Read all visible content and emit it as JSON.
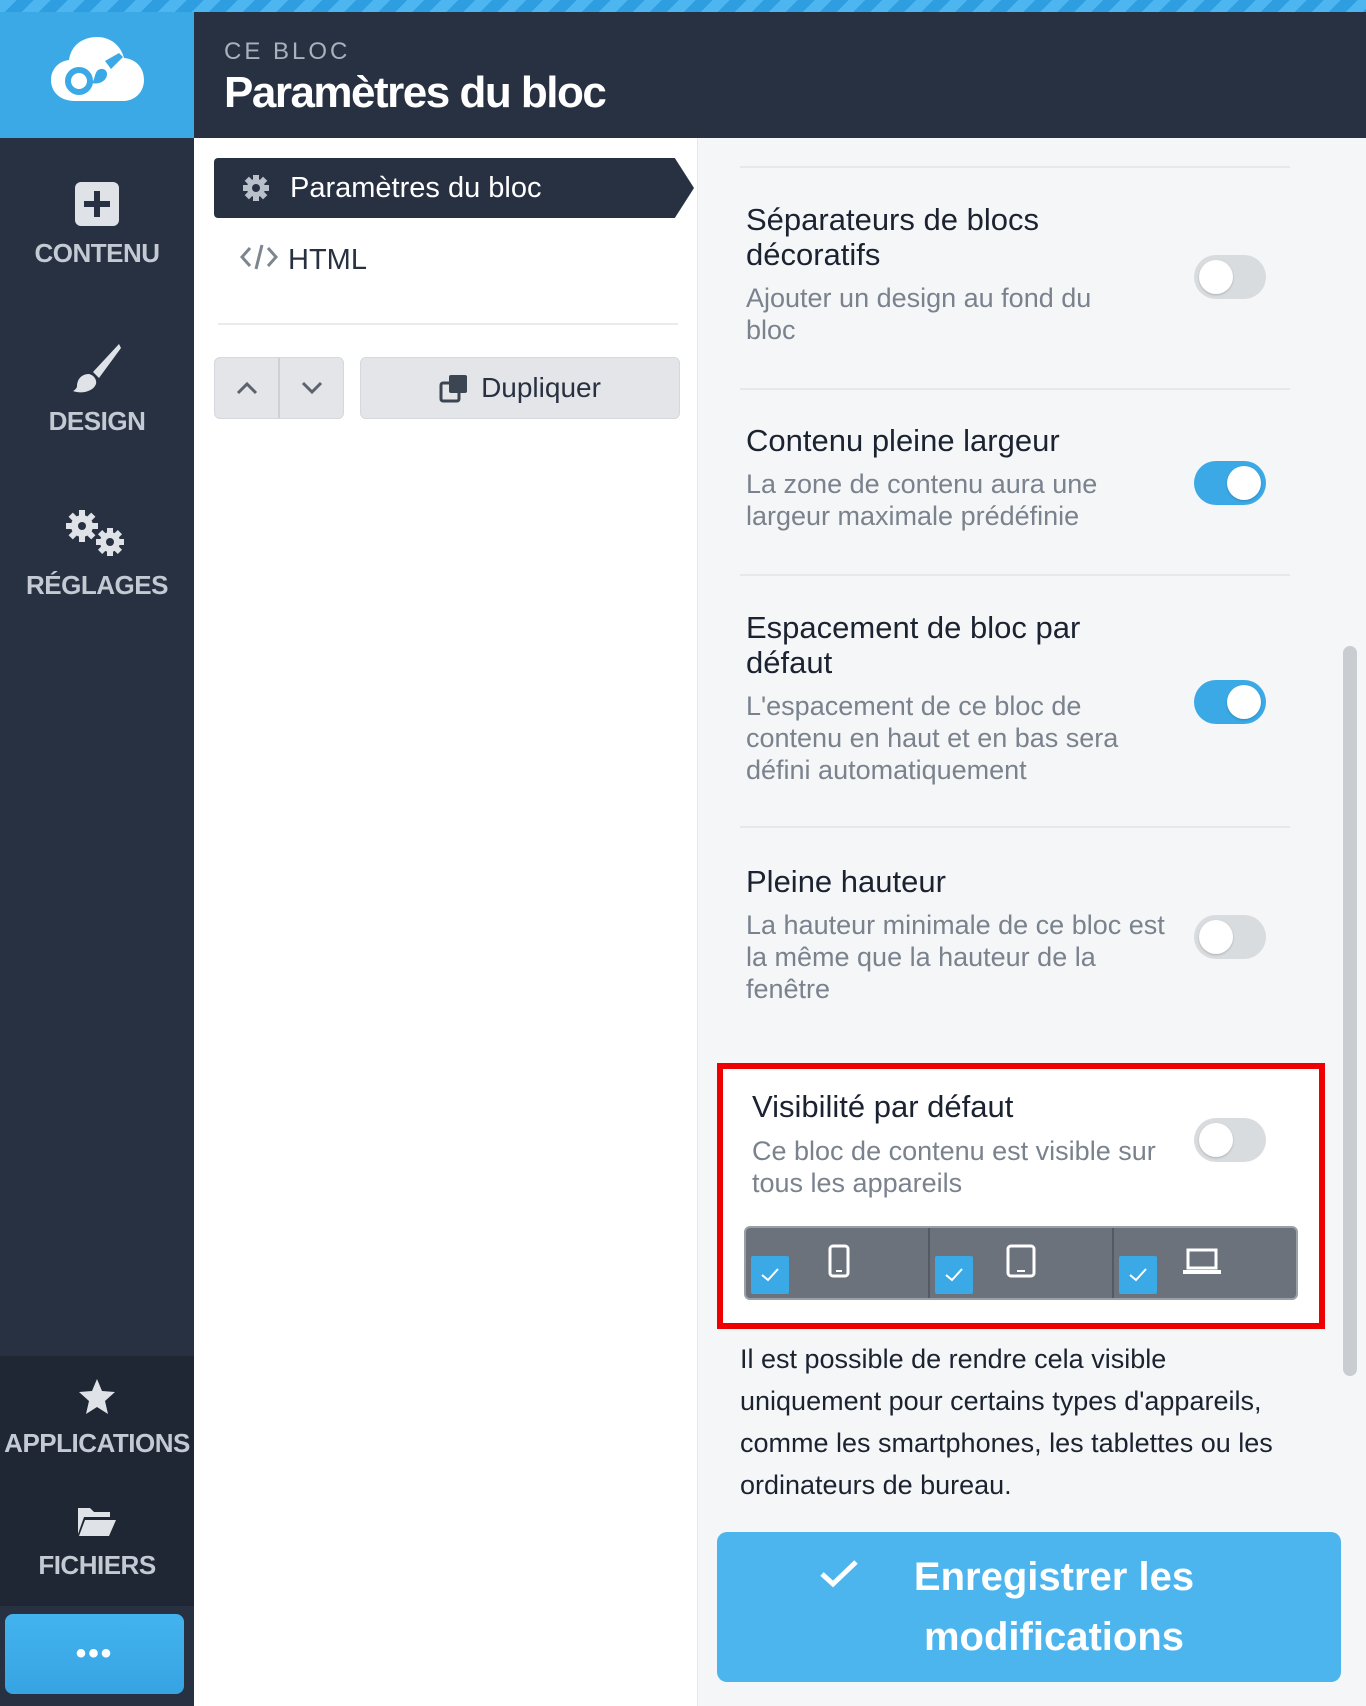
{
  "sidebar": {
    "logo": "cloud-brush-logo",
    "items": [
      {
        "label": "CONTENU",
        "icon": "plus-square-icon"
      },
      {
        "label": "DESIGN",
        "icon": "brush-icon"
      },
      {
        "label": "RÉGLAGES",
        "icon": "gears-icon"
      },
      {
        "label": "APPLICATIONS",
        "icon": "star-icon"
      },
      {
        "label": "FICHIERS",
        "icon": "folder-open-icon"
      }
    ],
    "more_label": "•••"
  },
  "header": {
    "eyebrow": "CE BLOC",
    "title": "Paramètres du bloc"
  },
  "middle": {
    "tabs": [
      {
        "label": "Paramètres du bloc",
        "icon": "gear-icon",
        "active": true
      },
      {
        "label": "HTML",
        "icon": "code-icon",
        "active": false
      }
    ],
    "duplicate_label": "Dupliquer"
  },
  "settings": [
    {
      "title": "Séparateurs de blocs décoratifs",
      "desc": "Ajouter un design au fond du bloc",
      "on": false
    },
    {
      "title": "Contenu pleine largeur",
      "desc": "La zone de contenu aura une largeur maximale prédéfinie",
      "on": true
    },
    {
      "title": "Espacement de bloc par défaut",
      "desc": "L'espacement de ce bloc de contenu en haut et en bas sera défini automatiquement",
      "on": true
    },
    {
      "title": "Pleine hauteur",
      "desc": "La hauteur minimale de ce bloc est la même que la hauteur de la fenêtre",
      "on": false
    }
  ],
  "visibility": {
    "title": "Visibilité par défaut",
    "desc": "Ce bloc de contenu est visible sur tous les appareils",
    "on": false,
    "devices": [
      {
        "icon": "smartphone-icon",
        "checked": true
      },
      {
        "icon": "tablet-icon",
        "checked": true
      },
      {
        "icon": "laptop-icon",
        "checked": true
      }
    ],
    "highlight_color": "#ef0000"
  },
  "help_text": "Il est possible de rendre cela visible uniquement pour certains types d'appareils, comme les smartphones, les tablettes ou les ordinateurs de bureau.",
  "save": {
    "label": "Enregistrer les modifications"
  },
  "colors": {
    "accent": "#3aa9e6",
    "sidebar_bg": "#283142"
  }
}
